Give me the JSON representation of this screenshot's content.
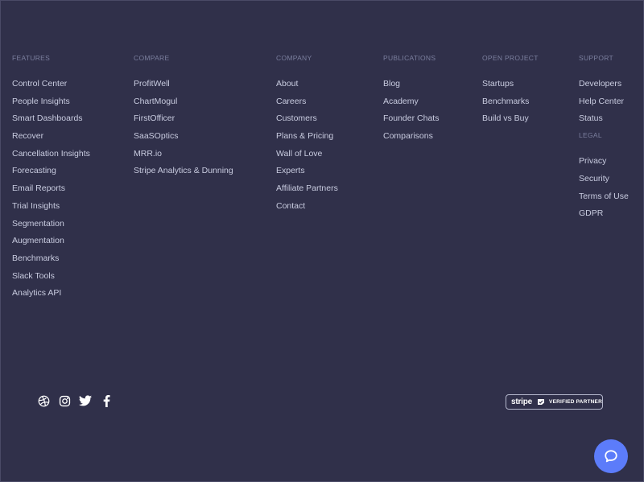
{
  "columns": [
    {
      "heading": "FEATURES",
      "links": [
        "Control Center",
        "People Insights",
        "Smart Dashboards",
        "Recover",
        "Cancellation Insights",
        "Forecasting",
        "Email Reports",
        "Trial Insights",
        "Segmentation",
        "Augmentation",
        "Benchmarks",
        "Slack Tools",
        "Analytics API"
      ]
    },
    {
      "heading": "COMPARE",
      "links": [
        "ProfitWell",
        "ChartMogul",
        "FirstOfficer",
        "SaaSOptics",
        "MRR.io",
        "Stripe Analytics & Dunning"
      ]
    },
    {
      "heading": "COMPANY",
      "links": [
        "About",
        "Careers",
        "Customers",
        "Plans & Pricing",
        "Wall of Love",
        "Experts",
        "Affiliate Partners",
        "Contact"
      ]
    },
    {
      "heading": "PUBLICATIONS",
      "links": [
        "Blog",
        "Academy",
        "Founder Chats",
        "Comparisons"
      ]
    },
    {
      "heading": "OPEN PROJECT",
      "links": [
        "Startups",
        "Benchmarks",
        "Build vs Buy"
      ]
    },
    {
      "heading": "SUPPORT",
      "links": [
        "Developers",
        "Help Center",
        "Status"
      ],
      "sub_heading": "LEGAL",
      "sub_links": [
        "Privacy",
        "Security",
        "Terms of Use",
        "GDPR"
      ]
    }
  ],
  "social_icons": [
    "dribbble-icon",
    "instagram-icon",
    "twitter-icon",
    "facebook-icon"
  ],
  "stripe_badge": {
    "brand": "stripe",
    "label": "VERIFIED PARTNER"
  },
  "chat_button": {
    "icon": "chat-bubble-icon"
  },
  "colors": {
    "background": "#30304a",
    "heading": "#7b7f9e",
    "link": "#c9cce0",
    "chat_button": "#5c7cfa"
  }
}
